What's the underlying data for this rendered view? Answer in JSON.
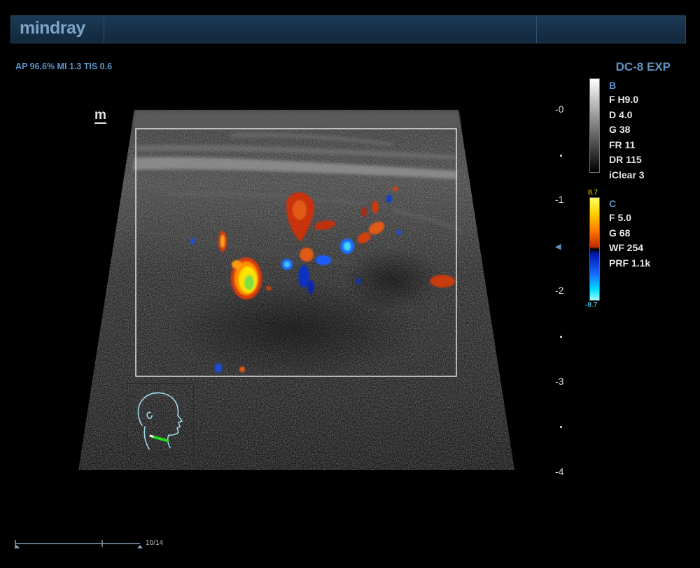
{
  "header": {
    "brand": "mindray"
  },
  "acoustic_output": "AP 96.6%  MI 1.3  TIS 0.6",
  "probe": {
    "model": "DC-8 EXP"
  },
  "image_marker": "m",
  "depth_scale": {
    "labels": [
      {
        "value": 0,
        "text": "-0"
      },
      {
        "value": 1,
        "text": "-1"
      },
      {
        "value": 2,
        "text": "-2"
      },
      {
        "value": 3,
        "text": "-3"
      },
      {
        "value": 4,
        "text": "-4"
      }
    ],
    "focus_depth": 1.5,
    "max_depth": 4.0
  },
  "b_mode": {
    "label": "B",
    "params": [
      "F H9.0",
      "D 4.0",
      "G 38",
      "FR 11",
      "DR 115",
      "iClear 3"
    ]
  },
  "color_mode": {
    "label": "C",
    "scale_max": "8.7",
    "scale_min": "-8.7",
    "params": [
      "F 5.0",
      "G 68",
      "WF 254",
      "PRF 1.1k"
    ]
  },
  "cine": {
    "frame_text": "10/14",
    "current": 10,
    "total": 14
  },
  "colors": {
    "ui_blue": "#5f93c5",
    "header_bg": "#17324a",
    "flow_red": "#d83a10",
    "flow_yellow": "#ffe000",
    "flow_blue": "#1a5cff",
    "pictogram": "#9fd8e8",
    "probe_mark": "#22dd22"
  },
  "icons": {
    "body_marker": "head-neck-pictogram-icon",
    "focus": "focus-triangle-icon"
  }
}
